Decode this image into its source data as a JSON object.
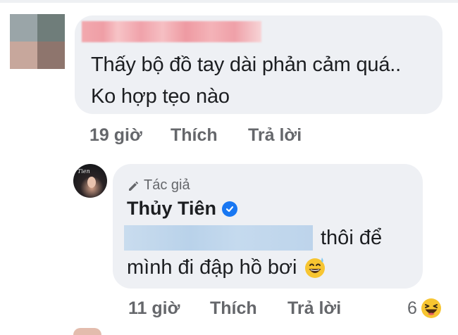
{
  "comment1": {
    "text": "Thấy bộ đồ tay dài phản cảm quá.. Ko hợp tẹo nào",
    "time": "19 giờ",
    "like_label": "Thích",
    "reply_label": "Trả lời"
  },
  "comment2": {
    "badge": "Tác giả",
    "author": "Thủy Tiên",
    "text_line1": "thôi để",
    "text_line2": "mình đi đập hồ bơi",
    "time": "11 giờ",
    "like_label": "Thích",
    "reply_label": "Trả lời",
    "reaction_count": "6"
  },
  "colors": {
    "bubble": "#eef0f4",
    "meta_text": "#65676b",
    "verified": "#1877f2",
    "name_blur": "#f2a9ae",
    "mention_blur": "#c5daee"
  },
  "icons": {
    "author_badge": "pencil-icon",
    "verified": "verified-check-icon",
    "emoji": "grinning-sweat-emoji-icon",
    "reaction": "haha-reaction-icon"
  }
}
